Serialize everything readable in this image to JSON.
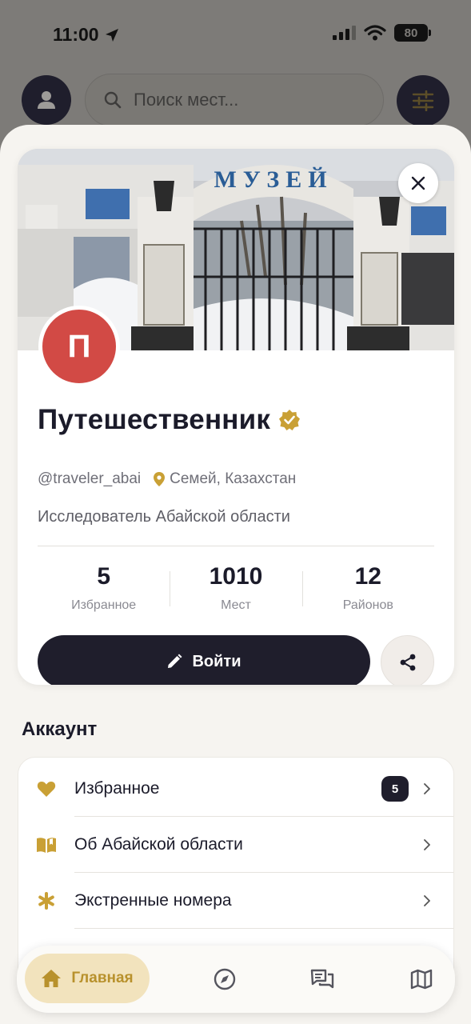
{
  "status_bar": {
    "time": "11:00",
    "battery": "80"
  },
  "top_bar": {
    "search_placeholder": "Поиск мест..."
  },
  "profile": {
    "avatar_letter": "П",
    "name": "Путешественник",
    "username": "@traveler_abai",
    "location": "Семей, Казахстан",
    "bio": "Исследователь Абайской области",
    "cover_sign_text": "МУЗЕЙ",
    "stats": [
      {
        "value": "5",
        "label": "Избранное"
      },
      {
        "value": "1010",
        "label": "Мест"
      },
      {
        "value": "12",
        "label": "Районов"
      }
    ],
    "login_label": "Войти"
  },
  "account": {
    "title": "Аккаунт",
    "items": [
      {
        "label": "Избранное",
        "icon": "heart-icon",
        "badge": "5"
      },
      {
        "label": "Об Абайской области",
        "icon": "book-icon"
      },
      {
        "label": "Экстренные номера",
        "icon": "asterisk-icon"
      }
    ]
  },
  "tab_bar": {
    "home_label": "Главная",
    "tabs": [
      "home-icon",
      "compass-icon",
      "chat-icon",
      "map-icon"
    ]
  },
  "colors": {
    "accent_gold": "#b8912c",
    "dark": "#1f1e2c",
    "avatar_red": "#d24a45",
    "home_pill": "#f2e3bd"
  }
}
